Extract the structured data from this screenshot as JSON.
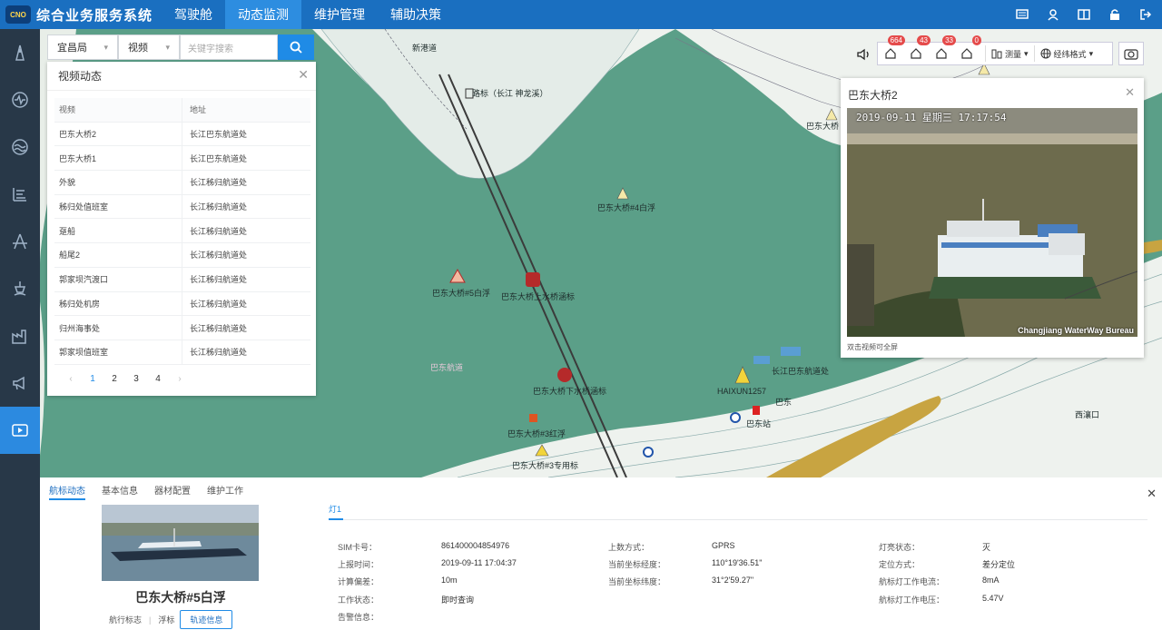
{
  "app": {
    "logo_text": "CNO",
    "title": "综合业务服务系统",
    "nav": [
      "驾驶舱",
      "动态监测",
      "维护管理",
      "辅助决策"
    ],
    "active_nav": 1
  },
  "top_icons": [
    "monitor-icon",
    "user-icon",
    "layout-icon",
    "lock-icon",
    "logout-icon"
  ],
  "sidebar_icons": [
    "beacon-icon",
    "wave-monitor-icon",
    "water-icon",
    "channel-icon",
    "bridge-icon",
    "buoy-icon",
    "factory-icon",
    "broadcast-icon",
    "video-icon"
  ],
  "search": {
    "org": "宜昌局",
    "type": "视频",
    "placeholder": "关键字搜索"
  },
  "video_panel": {
    "title": "视频动态",
    "columns": [
      "视频",
      "地址"
    ],
    "rows": [
      [
        "巴东大桥2",
        "长江巴东航道处"
      ],
      [
        "巴东大桥1",
        "长江巴东航道处"
      ],
      [
        "外貌",
        "长江秭归航道处"
      ],
      [
        "秭归处值班室",
        "长江秭归航道处"
      ],
      [
        "趸船",
        "长江秭归航道处"
      ],
      [
        "船尾2",
        "长江秭归航道处"
      ],
      [
        "郭家坝汽渡口",
        "长江秭归航道处"
      ],
      [
        "秭归处机房",
        "长江秭归航道处"
      ],
      [
        "归州海事处",
        "长江秭归航道处"
      ],
      [
        "郭家坝值班室",
        "长江秭归航道处"
      ]
    ],
    "pages": [
      "1",
      "2",
      "3",
      "4"
    ],
    "current_page": "1"
  },
  "map_tools": {
    "badges": [
      "664",
      "43",
      "33",
      "0"
    ],
    "measure": "测量",
    "coord_format": "经纬格式"
  },
  "map_labels": {
    "l1": "新港道",
    "l2": "路标（长江 神龙溪）",
    "l3": "巴东大桥#4白浮",
    "l4": "巴东大桥#5白浮",
    "l5": "巴东大桥上水桥涵标",
    "l6": "巴东大桥下水桥涵标",
    "l7": "巴东航道",
    "l8": "巴东大桥#3红浮",
    "l9": "巴东大桥#3专用标",
    "l10": "HAIXUN1257",
    "l11": "巴东站",
    "l12": "巴东大桥",
    "l13": "巴东",
    "l14": "长江巴东航道处",
    "l15": "西瀼口"
  },
  "video_popup": {
    "title": "巴东大桥2",
    "timestamp": "2019-09-11 星期三 17:17:54",
    "watermark": "Changjiang WaterWay Bureau",
    "hint": "双击视频可全屏"
  },
  "bottom": {
    "tabs": [
      "航标动态",
      "基本信息",
      "器材配置",
      "维护工作"
    ],
    "name": "巴东大桥#5白浮",
    "link1": "航行标志",
    "link2": "浮标",
    "track": "轨迹信息",
    "light_tab": "灯1",
    "info": {
      "sim_k": "SIM卡号：",
      "sim_v": "861400004854976",
      "report_time_k": "上报时间：",
      "report_time_v": "2019-09-11 17:04:37",
      "offset_k": "计算偏差：",
      "offset_v": "10m",
      "work_k": "工作状态：",
      "work_v": "即时查询",
      "alarm_k": "告警信息：",
      "upload_k": "上数方式：",
      "upload_v": "GPRS",
      "lon_k": "当前坐标经度：",
      "lon_v": "110°19'36.51\"",
      "lat_k": "当前坐标纬度：",
      "lat_v": "31°2'59.27\"",
      "light_k": "灯亮状态：",
      "light_v": "灭",
      "pos_k": "定位方式：",
      "pos_v": "差分定位",
      "current_k": "航标灯工作电流：",
      "current_v": "8mA",
      "voltage_k": "航标灯工作电压：",
      "voltage_v": "5.47V"
    }
  }
}
